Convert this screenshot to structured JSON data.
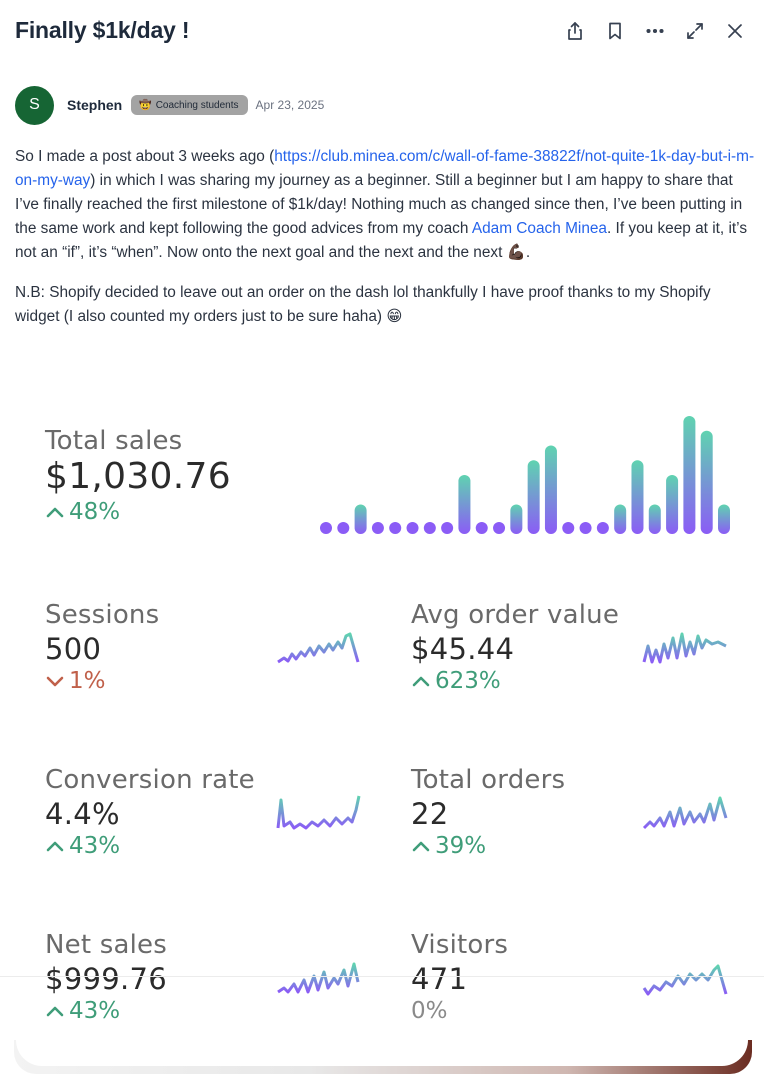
{
  "post": {
    "title": "Finally $1k/day !",
    "author": {
      "initial": "S",
      "name": "Stephen",
      "avatar_color": "#166534",
      "badge_emoji": "🤠",
      "badge_label": "Coaching students",
      "date": "Apr 23, 2025"
    },
    "body": {
      "p1_before_link": "So I made a post about 3 weeks ago (",
      "p1_link": "https://club.minea.com/c/wall-of-fame-38822f/not-quite-1k-day-but-i-m-on-my-way",
      "p1_after_link": ") in which I was sharing my journey as a beginner. Still a beginner but I am happy to share that I’ve finally reached the first milestone of $1k/day! Nothing much as changed since then, I’ve been putting in the same work and kept following the good advices from my coach ",
      "p1_mention": "Adam Coach Minea",
      "p1_end": ". If you keep at it, it’s not an “if”, it’s “when”. Now onto the next goal and the next and the next 💪🏿.",
      "p2": "N.B: Shopify decided to leave out an order on the dash lol thankfully I have proof thanks to my Shopify widget (I also counted my orders just to be sure haha) 😁"
    }
  },
  "header_icons": [
    "share-icon",
    "bookmark-icon",
    "more-icon",
    "expand-icon",
    "close-icon"
  ],
  "widget": {
    "total_sales": {
      "label": "Total sales",
      "value": "$1,030.76",
      "change": "48%",
      "direction": "up",
      "bars": [
        1,
        1,
        2,
        1,
        1,
        1,
        1,
        1,
        4,
        1,
        1,
        2,
        5,
        6,
        1,
        1,
        1,
        2,
        5,
        2,
        4,
        8,
        7,
        2
      ]
    },
    "sessions": {
      "label": "Sessions",
      "value": "500",
      "change": "1%",
      "direction": "down"
    },
    "avg_order_value": {
      "label": "Avg order value",
      "value": "$45.44",
      "change": "623%",
      "direction": "up"
    },
    "conversion_rate": {
      "label": "Conversion rate",
      "value": "4.4%",
      "change": "43%",
      "direction": "up"
    },
    "total_orders": {
      "label": "Total orders",
      "value": "22",
      "change": "39%",
      "direction": "up"
    },
    "net_sales": {
      "label": "Net sales",
      "value": "$999.76",
      "change": "43%",
      "direction": "up"
    },
    "visitors": {
      "label": "Visitors",
      "value": "471",
      "change": "0%",
      "direction": "flat"
    }
  },
  "colors": {
    "up": "#3f9d79",
    "down": "#c0604a",
    "link": "#2563eb",
    "bar_top": "#5fd3b0",
    "bar_bottom": "#8b5cf6"
  }
}
